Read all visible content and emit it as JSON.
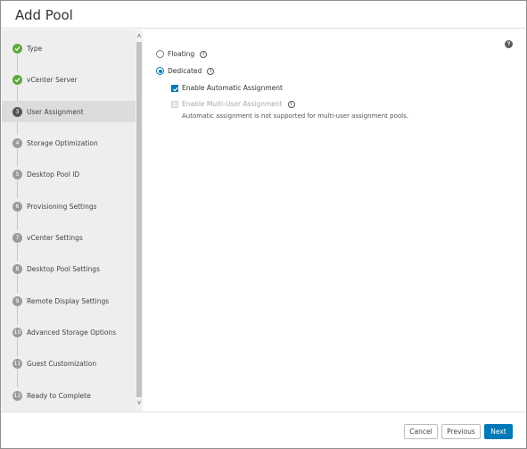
{
  "dialog": {
    "title": "Add Pool"
  },
  "steps": [
    {
      "number": "1",
      "label": "Type",
      "state": "done"
    },
    {
      "number": "2",
      "label": "vCenter Server",
      "state": "done"
    },
    {
      "number": "3",
      "label": "User Assignment",
      "state": "current"
    },
    {
      "number": "4",
      "label": "Storage Optimization",
      "state": "pending"
    },
    {
      "number": "5",
      "label": "Desktop Pool ID",
      "state": "pending"
    },
    {
      "number": "6",
      "label": "Provisioning Settings",
      "state": "pending"
    },
    {
      "number": "7",
      "label": "vCenter Settings",
      "state": "pending"
    },
    {
      "number": "8",
      "label": "Desktop Pool Settings",
      "state": "pending"
    },
    {
      "number": "9",
      "label": "Remote Display Settings",
      "state": "pending"
    },
    {
      "number": "10",
      "label": "Advanced Storage Options",
      "state": "pending"
    },
    {
      "number": "11",
      "label": "Guest Customization",
      "state": "pending"
    },
    {
      "number": "12",
      "label": "Ready to Complete",
      "state": "pending"
    }
  ],
  "assignment": {
    "floating_label": "Floating",
    "dedicated_label": "Dedicated",
    "selected": "Dedicated",
    "auto_assign_label": "Enable Automatic Assignment",
    "auto_assign_checked": true,
    "multi_user_label": "Enable Multi-User Assignment",
    "multi_user_checked": false,
    "multi_user_disabled": true,
    "note": "Automatic assignment is not supported for multi-user assignment pools."
  },
  "footer": {
    "cancel_label": "Cancel",
    "previous_label": "Previous",
    "next_label": "Next"
  },
  "colors": {
    "primary": "#0079b8",
    "done": "#61a83f"
  }
}
